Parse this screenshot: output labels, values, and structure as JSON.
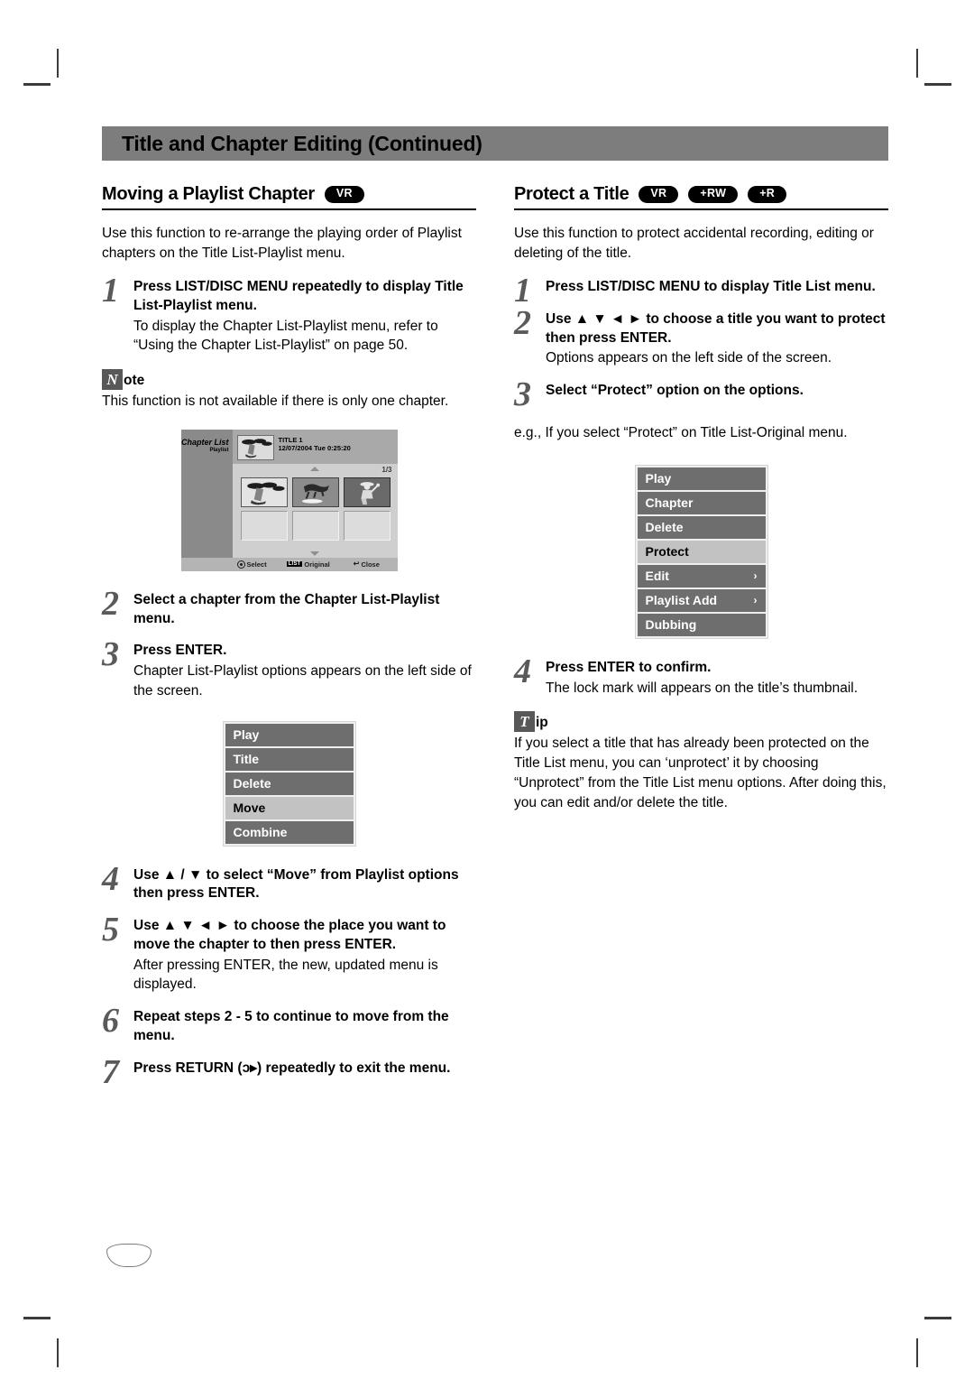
{
  "header": {
    "title": "Title and Chapter Editing (Continued)"
  },
  "left_column": {
    "section_title": "Moving a Playlist Chapter",
    "badges": [
      "VR"
    ],
    "intro": "Use this function to re-arrange the playing order of Playlist chapters on the Title List-Playlist menu.",
    "steps_top": [
      {
        "num": "1",
        "title": "Press LIST/DISC MENU repeatedly to display Title List-Playlist menu.",
        "sub": "To display the Chapter List-Playlist menu, refer to “Using the Chapter List-Playlist” on page 50."
      }
    ],
    "note": {
      "glyph": "N",
      "word": "ote",
      "text": "This function is not available if there is only one chapter."
    },
    "screen": {
      "label_line1": "Chapter List",
      "label_line2": "Playlist",
      "title_line1": "TITLE 1",
      "title_line2": "12/07/2004  Tue 0:25:20",
      "page_count": "1/3",
      "cells": [
        "light",
        "mid",
        "dark",
        "empty",
        "empty",
        "empty"
      ],
      "footer": {
        "select": "Select",
        "list_key": "LIST",
        "original": "Original",
        "close": "Close"
      }
    },
    "steps_mid": [
      {
        "num": "2",
        "title": "Select a chapter from the Chapter List-Playlist menu.",
        "sub": ""
      },
      {
        "num": "3",
        "title": "Press ENTER.",
        "sub": "Chapter List-Playlist options appears on the left side of the screen."
      }
    ],
    "options_menu": [
      {
        "label": "Play",
        "selected": false,
        "submenu": false
      },
      {
        "label": "Title",
        "selected": false,
        "submenu": false
      },
      {
        "label": "Delete",
        "selected": false,
        "submenu": false
      },
      {
        "label": "Move",
        "selected": true,
        "submenu": false
      },
      {
        "label": "Combine",
        "selected": false,
        "submenu": false
      }
    ],
    "steps_bottom": [
      {
        "num": "4",
        "title": "Use ▲ / ▼ to select “Move” from Playlist options then press ENTER.",
        "sub": ""
      },
      {
        "num": "5",
        "title": "Use ▲ ▼ ◄ ► to choose the place you want to move the chapter to then press ENTER.",
        "sub": "After pressing ENTER, the new, updated menu is displayed."
      },
      {
        "num": "6",
        "title": "Repeat steps 2 - 5 to continue to move from the menu.",
        "sub": ""
      },
      {
        "num": "7",
        "title": "Press RETURN (ɔ▸) repeatedly to exit the menu.",
        "sub": ""
      }
    ]
  },
  "right_column": {
    "section_title": "Protect a Title",
    "badges": [
      "VR",
      "+RW",
      "+R"
    ],
    "intro": "Use this function to protect accidental recording, editing or deleting of the title.",
    "steps_top": [
      {
        "num": "1",
        "title": "Press LIST/DISC MENU to display Title List menu.",
        "sub": ""
      },
      {
        "num": "2",
        "title": "Use ▲ ▼ ◄ ► to choose a title you want to protect then press ENTER.",
        "sub": "Options appears on the left side of the screen."
      },
      {
        "num": "3",
        "title": "Select “Protect” option on the options.",
        "sub": ""
      }
    ],
    "example_text": "e.g., If you select “Protect” on Title List-Original menu.",
    "options_menu": [
      {
        "label": "Play",
        "selected": false,
        "submenu": false
      },
      {
        "label": "Chapter",
        "selected": false,
        "submenu": false
      },
      {
        "label": "Delete",
        "selected": false,
        "submenu": false
      },
      {
        "label": "Protect",
        "selected": true,
        "submenu": false
      },
      {
        "label": "Edit",
        "selected": false,
        "submenu": true
      },
      {
        "label": "Playlist Add",
        "selected": false,
        "submenu": true
      },
      {
        "label": "Dubbing",
        "selected": false,
        "submenu": false
      }
    ],
    "steps_bottom": [
      {
        "num": "4",
        "title": "Press ENTER to confirm.",
        "sub": "The lock mark will appears on the title’s thumbnail."
      }
    ],
    "tip": {
      "glyph": "T",
      "word": "ip",
      "text": "If you select a title that has already been protected on the Title List menu, you can ‘unprotect’ it by choosing “Unprotect” from the Title List menu options. After doing this, you can edit and/or delete the title."
    }
  },
  "page_number": ""
}
